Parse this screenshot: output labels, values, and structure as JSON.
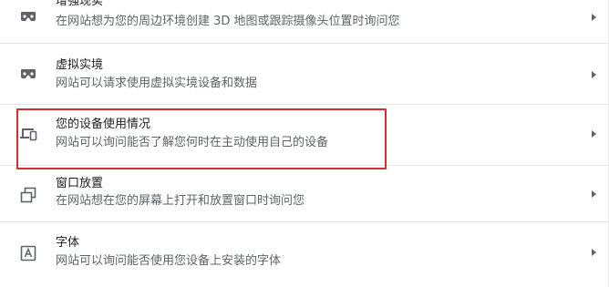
{
  "rows": [
    {
      "title": "增强现实",
      "subtitle": "在网站想为您的周边环境创建 3D 地图或跟踪摄像头位置时询问您",
      "icon": "vr-headset-icon"
    },
    {
      "title": "虚拟实境",
      "subtitle": "网站可以请求使用虚拟实境设备和数据",
      "icon": "vr-headset-icon"
    },
    {
      "title": "您的设备使用情况",
      "subtitle": "网站可以询问能否了解您何时在主动使用自己的设备",
      "icon": "devices-icon"
    },
    {
      "title": "窗口放置",
      "subtitle": "在网站想在您的屏幕上打开和放置窗口时询问您",
      "icon": "window-placement-icon"
    },
    {
      "title": "字体",
      "subtitle": "网站可以询问能否使用您设备上安装的字体",
      "icon": "font-icon"
    }
  ],
  "colors": {
    "highlight": "#d32f2f",
    "icon": "#5f6368",
    "divider": "#e5e5e5"
  }
}
